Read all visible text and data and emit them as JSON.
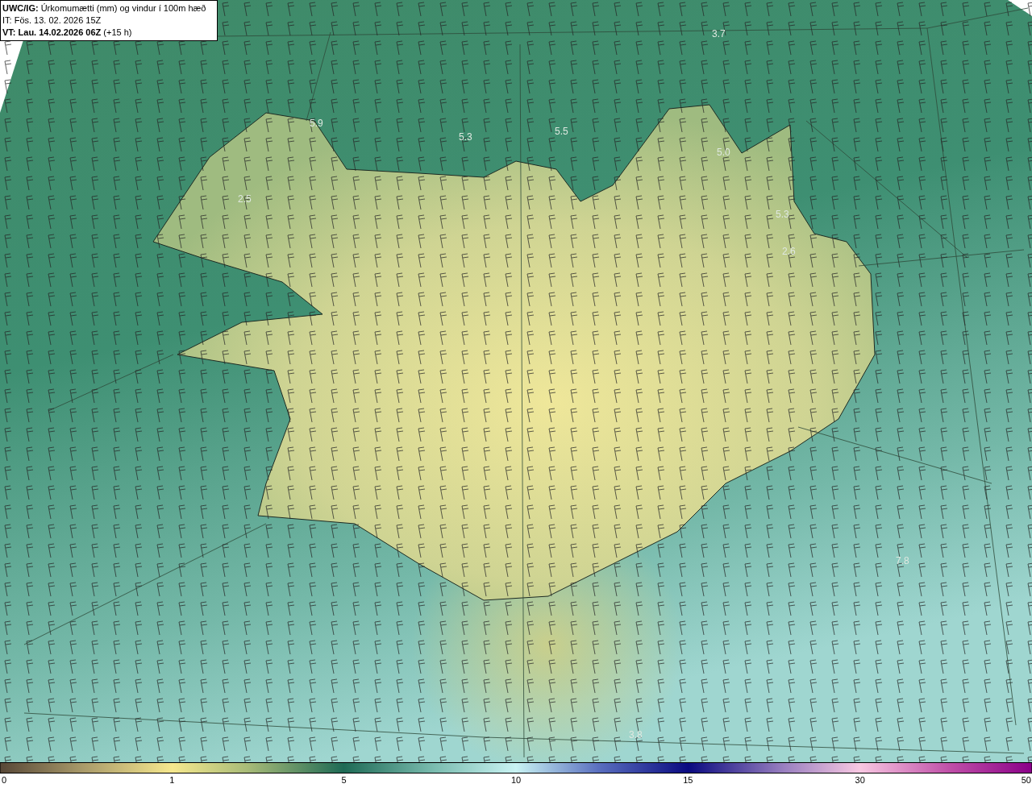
{
  "header": {
    "title": "**UWC/IG:** Úrkomumætti (mm) og vindur í 100m hæð",
    "issue_time": "IT: Fös. 13. 02. 2026 15Z",
    "valid_time": "**VT: Lau. 14.02.2026 06Z** (+15 h)"
  },
  "map": {
    "value_labels": [
      "3.7",
      "5.9",
      "5.3",
      "5.5",
      "5.0",
      "2.5",
      "5.3",
      "2.6",
      "7.8",
      "3.8"
    ]
  },
  "color_scale": {
    "ticks": [
      "0",
      "1",
      "5",
      "10",
      "15",
      "30",
      "50"
    ]
  }
}
